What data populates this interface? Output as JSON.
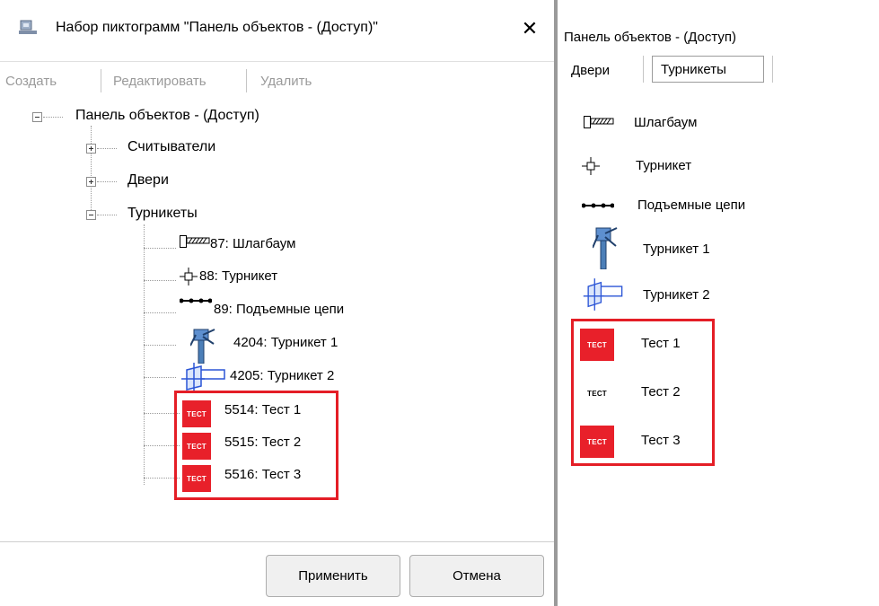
{
  "dialog": {
    "title": "Набор пиктограмм \"Панель объектов - (Доступ)\"",
    "close_label": "✕",
    "toolbar": {
      "create": "Создать",
      "edit": "Редактировать",
      "delete": "Удалить"
    },
    "tree": {
      "root": "Панель объектов - (Доступ)",
      "groups": [
        "Считыватели",
        "Двери",
        "Турникеты"
      ],
      "items": [
        {
          "label": "87: Шлагбаум",
          "icon": "barrier-icon"
        },
        {
          "label": "88: Турникет",
          "icon": "turnstile-icon"
        },
        {
          "label": "89: Подъемные цепи",
          "icon": "chain-icon"
        },
        {
          "label": "4204: Турникет 1",
          "icon": "turnstile-1-icon"
        },
        {
          "label": "4205: Турникет 2",
          "icon": "turnstile-2-icon"
        },
        {
          "label": "5514: Тест 1",
          "icon": "test-badge-icon",
          "badge": "ТЕСТ"
        },
        {
          "label": "5515: Тест 2",
          "icon": "test-badge-icon",
          "badge": "ТЕСТ"
        },
        {
          "label": "5516: Тест 3",
          "icon": "test-badge-icon",
          "badge": "ТЕСТ"
        }
      ]
    },
    "buttons": {
      "apply": "Применить",
      "cancel": "Отмена"
    }
  },
  "panel": {
    "title": "Панель объектов - (Доступ)",
    "tabs": [
      "Двери",
      "Турникеты"
    ],
    "active_tab": "Турникеты",
    "items": [
      {
        "label": "Шлагбаум",
        "icon": "barrier-icon"
      },
      {
        "label": "Турникет",
        "icon": "turnstile-icon"
      },
      {
        "label": "Подъемные цепи",
        "icon": "chain-icon"
      },
      {
        "label": "Турникет 1",
        "icon": "turnstile-1-icon"
      },
      {
        "label": "Турникет 2",
        "icon": "turnstile-2-icon"
      },
      {
        "label": "Тест 1",
        "icon": "test-badge-icon",
        "badge": "ТЕСТ"
      },
      {
        "label": "Тест 2",
        "icon": "test-text-icon",
        "badge": "ТЕСТ"
      },
      {
        "label": "Тест 3",
        "icon": "test-badge-icon",
        "badge": "ТЕСТ"
      }
    ]
  },
  "colors": {
    "highlight": "#e41e26",
    "badge": "#e8202a",
    "disabled_text": "#9a9a9a"
  }
}
